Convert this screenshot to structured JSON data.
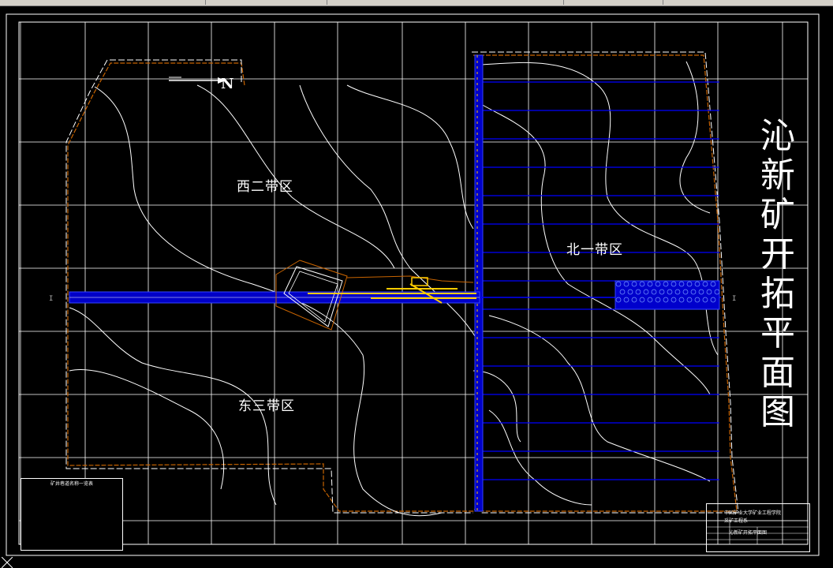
{
  "drawing": {
    "title": "沁新矿开拓平面图",
    "north_label": "N",
    "zones": [
      {
        "id": "west2",
        "label": "西二带区"
      },
      {
        "id": "north1",
        "label": "北一带区"
      },
      {
        "id": "east3",
        "label": "东三带区"
      }
    ],
    "section_mark_left": "I",
    "section_mark_right": "I",
    "legend_title": "矿井巷道名称一览表",
    "title_block": {
      "line1": "中国矿业大学矿业工程学院",
      "line2": "采矿工程系",
      "line3": "沁新矿开拓平面图"
    }
  },
  "colors": {
    "background": "#000000",
    "grid": "#ffffff",
    "roadway": "#0000ff",
    "boundary": "#c86400",
    "main_shaft": "#ffcc00",
    "contour": "#ffffff"
  }
}
